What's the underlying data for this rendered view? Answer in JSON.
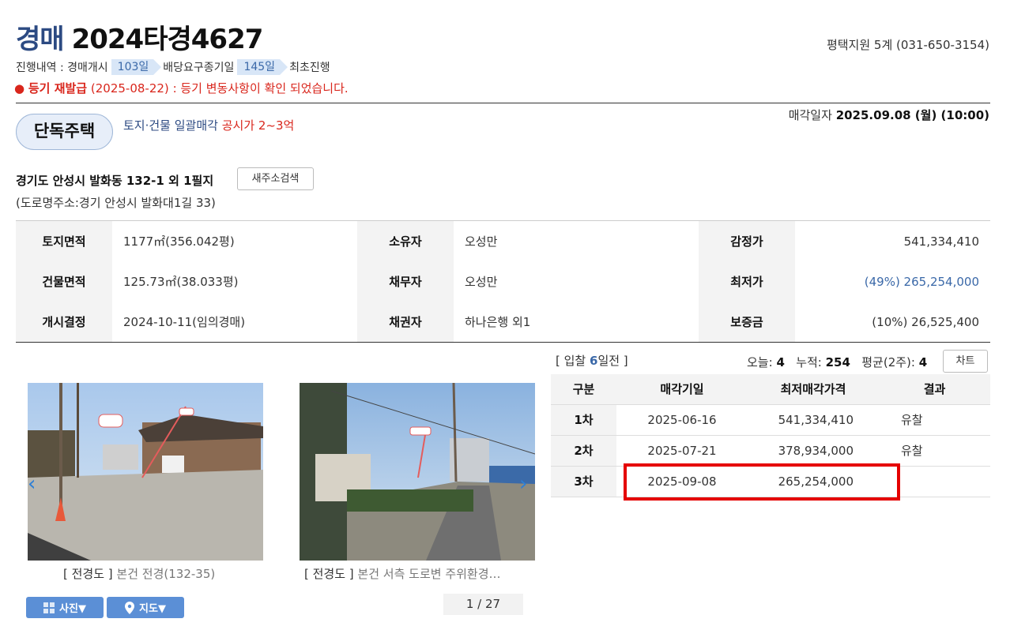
{
  "header": {
    "kind": "경매",
    "case_number": "2024타경4627",
    "court": "평택지원 5계 (031-650-3154)"
  },
  "progress": {
    "label1": "진행내역 : 경매개시",
    "days1": "103일",
    "label2": "배당요구종기일",
    "days2": "145일",
    "label3": "최초진행"
  },
  "notice": {
    "title": "등기 재발급",
    "date": "(2025-08-22)",
    "message": ": 등기 변동사항이 확인 되었습니다."
  },
  "property": {
    "type": "단독주택",
    "sale_method": "토지·건물 일괄매각",
    "price_note": "공시가 2~3억",
    "sale_date_label": "매각일자",
    "sale_date": "2025.09.08 (월) (10:00)",
    "address": "경기도 안성시 발화동 132-1 외 1필지",
    "new_address_button": "새주소검색",
    "road_address": "(도로명주소:경기 안성시 발화대1길 33)"
  },
  "info": {
    "rows": [
      {
        "l1": "토지면적",
        "v1": "1177㎡(356.042평)",
        "l2": "소유자",
        "v2": "오성만",
        "l3": "감정가",
        "v3": "541,334,410"
      },
      {
        "l1": "건물면적",
        "v1": "125.73㎡(38.033평)",
        "l2": "채무자",
        "v2": "오성만",
        "l3": "최저가",
        "v3": "(49%) 265,254,000"
      },
      {
        "l1": "개시결정",
        "v1": "2024-10-11(임의경매)",
        "l2": "채권자",
        "v2": "하나은행 외1",
        "l3": "보증금",
        "v3": "(10%) 26,525,400"
      }
    ]
  },
  "photos": {
    "caption1_tag": "[ 전경도 ]",
    "caption1_text": "본건 전경(132-35)",
    "caption2_tag": "[ 전경도 ]",
    "caption2_text": "본건 서측 도로변 주위환경…",
    "photo_button": "사진▼",
    "map_button": "지도▼",
    "pager": "1 / 27"
  },
  "bids": {
    "prefix": "[ 입찰 ",
    "count": "6",
    "suffix": "일전 ]",
    "today_label": "오늘:",
    "today": "4",
    "total_label": "누적:",
    "total": "254",
    "avg_label": "평균(2주):",
    "avg": "4",
    "chart_button": "차트"
  },
  "history": {
    "headers": [
      "구분",
      "매각기일",
      "최저매각가격",
      "결과"
    ],
    "rows": [
      {
        "round": "1차",
        "date": "2025-06-16",
        "price": "541,334,410",
        "result": "유찰"
      },
      {
        "round": "2차",
        "date": "2025-07-21",
        "price": "378,934,000",
        "result": "유찰"
      },
      {
        "round": "3차",
        "date": "2025-09-08",
        "price": "265,254,000",
        "result": ""
      }
    ]
  },
  "colors": {
    "accent_blue": "#2c4a82",
    "alert_red": "#d9261c",
    "highlight_red": "#e50000"
  }
}
